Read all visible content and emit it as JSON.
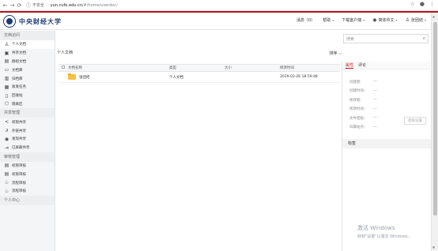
{
  "browser": {
    "security_label": "不安全",
    "host": "yun.cufe.edu.cn",
    "path": "/#/home/userdoc/"
  },
  "header": {
    "brand": "中央财经大学",
    "menu": {
      "messages": "消息（0）",
      "help": "帮助",
      "download_client": "下载客户端",
      "language": "简体中文",
      "user": "张团结"
    }
  },
  "sidebar": {
    "sections": [
      {
        "title": "文档访问",
        "items": [
          {
            "label": "个人文档",
            "icon": "person-icon",
            "active": true
          },
          {
            "label": "共享文档",
            "icon": "share-folder-icon"
          },
          {
            "label": "群组文档",
            "icon": "group-icon"
          },
          {
            "label": "文档库",
            "icon": "library-icon"
          },
          {
            "label": "归档库",
            "icon": "archive-icon"
          },
          {
            "label": "收发任务",
            "icon": "task-icon"
          },
          {
            "label": "回收站",
            "icon": "trash-icon"
          },
          {
            "label": "隔离区",
            "icon": "quarantine-icon"
          }
        ]
      },
      {
        "title": "共享管理",
        "items": [
          {
            "label": "权限共享",
            "icon": "share-icon"
          },
          {
            "label": "外链共享",
            "icon": "link-icon"
          },
          {
            "label": "发现共享",
            "icon": "eye-icon"
          },
          {
            "label": "已屏蔽共享",
            "icon": "block-icon"
          }
        ]
      },
      {
        "title": "审核管理",
        "items": [
          {
            "label": "权限审核",
            "icon": "audit-icon"
          },
          {
            "label": "权限审核",
            "icon": "audit-icon"
          },
          {
            "label": "流程审核",
            "icon": "flow-icon"
          },
          {
            "label": "流程审核",
            "icon": "flow-icon"
          }
        ]
      },
      {
        "title": "个人中心",
        "items": []
      }
    ]
  },
  "main": {
    "breadcrumb": "个人文档",
    "sort_label": "排序",
    "columns": [
      "文档名称",
      "类型",
      "大小",
      "修改时间"
    ],
    "rows": [
      {
        "name": "张团结",
        "type": "个人文档",
        "size": "",
        "modified": "2019-02-26 18:59:48"
      }
    ]
  },
  "right": {
    "search_placeholder": "搜索",
    "tabs": [
      "属性",
      "评论"
    ],
    "props": [
      {
        "k": "创建者：",
        "v": "---"
      },
      {
        "k": "创建时间：",
        "v": "---"
      },
      {
        "k": "修改者：",
        "v": "---"
      },
      {
        "k": "修改时间：",
        "v": "---"
      },
      {
        "k": "文件密级：",
        "v": "---"
      },
      {
        "k": "归属站点：",
        "v": "---"
      }
    ],
    "classify_button": "密级设置",
    "tags_title": "标签"
  },
  "watermark": {
    "line1": "激活 Windows",
    "line2": "转到\"设置\"以激活 Windows。"
  },
  "colors": {
    "accent": "#b0171d",
    "brand": "#1f3b73",
    "folder": "#f5c242"
  }
}
